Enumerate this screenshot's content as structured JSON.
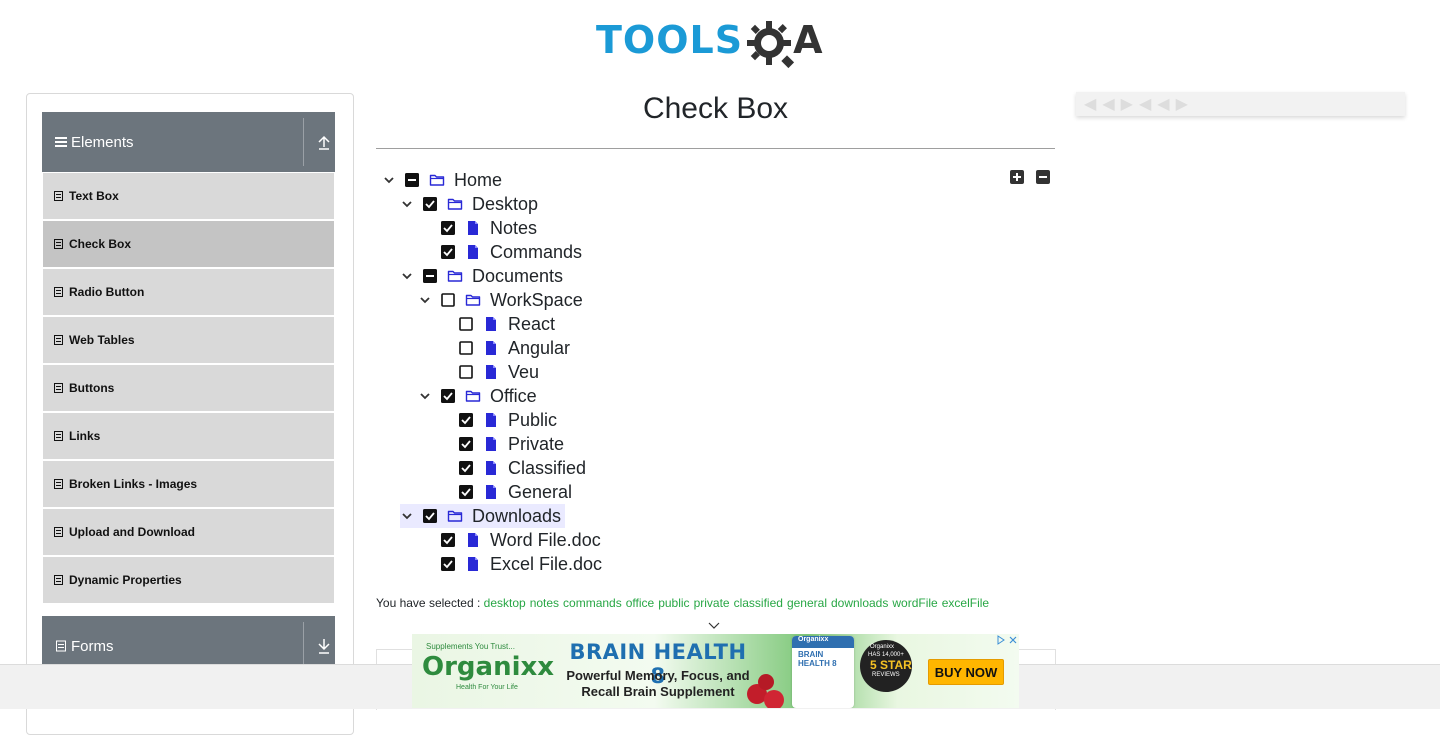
{
  "header": {
    "logo_text": "TOOLS",
    "logo_suffix": "A"
  },
  "sidebar": {
    "groups": [
      {
        "label": "Elements",
        "icon": "hamburger-icon",
        "arrow": "upload-arrow-icon"
      },
      {
        "label": "Forms",
        "icon": "form-icon",
        "arrow": "download-arrow-icon"
      }
    ],
    "items": [
      {
        "label": "Text Box",
        "active": false
      },
      {
        "label": "Check Box",
        "active": true
      },
      {
        "label": "Radio Button",
        "active": false
      },
      {
        "label": "Web Tables",
        "active": false
      },
      {
        "label": "Buttons",
        "active": false
      },
      {
        "label": "Links",
        "active": false
      },
      {
        "label": "Broken Links - Images",
        "active": false
      },
      {
        "label": "Upload and Download",
        "active": false
      },
      {
        "label": "Dynamic Properties",
        "active": false
      }
    ]
  },
  "main": {
    "title": "Check Box",
    "tree": [
      {
        "label": "Home",
        "type": "folder",
        "state": "partial",
        "expanded": true
      },
      {
        "label": "Desktop",
        "type": "folder",
        "state": "checked",
        "expanded": true
      },
      {
        "label": "Notes",
        "type": "file",
        "state": "checked"
      },
      {
        "label": "Commands",
        "type": "file",
        "state": "checked"
      },
      {
        "label": "Documents",
        "type": "folder",
        "state": "partial",
        "expanded": true
      },
      {
        "label": "WorkSpace",
        "type": "folder",
        "state": "unchecked",
        "expanded": true
      },
      {
        "label": "React",
        "type": "file",
        "state": "unchecked"
      },
      {
        "label": "Angular",
        "type": "file",
        "state": "unchecked"
      },
      {
        "label": "Veu",
        "type": "file",
        "state": "unchecked"
      },
      {
        "label": "Office",
        "type": "folder",
        "state": "checked",
        "expanded": true
      },
      {
        "label": "Public",
        "type": "file",
        "state": "checked"
      },
      {
        "label": "Private",
        "type": "file",
        "state": "checked"
      },
      {
        "label": "Classified",
        "type": "file",
        "state": "checked"
      },
      {
        "label": "General",
        "type": "file",
        "state": "checked"
      },
      {
        "label": "Downloads",
        "type": "folder",
        "state": "checked",
        "expanded": true
      },
      {
        "label": "Word File.doc",
        "type": "file",
        "state": "checked"
      },
      {
        "label": "Excel File.doc",
        "type": "file",
        "state": "checked"
      }
    ],
    "result_label": "You have selected :",
    "result_items": [
      "desktop",
      "notes",
      "commands",
      "office",
      "public",
      "private",
      "classified",
      "general",
      "downloads",
      "wordFile",
      "excelFile"
    ]
  },
  "ad_banner": {
    "brand": "Organixx",
    "brand_small": "Supplements You Trust...",
    "brand_tagline": "Health For Your Life",
    "headline": "BRAIN HEALTH 8",
    "subline": "Powerful Memory, Focus, and Recall Brain Supplement",
    "bottle_brand": "Organixx",
    "bottle_text": "BRAIN HEALTH 8",
    "badge_brand": "Organixx",
    "badge_line1": "HAS 14,000+",
    "badge_line2": "5 STAR",
    "badge_line3": "REVIEWS",
    "cta": "BUY NOW"
  },
  "colors": {
    "accent": "#1b9ad6",
    "sidebar_header": "#6c757d",
    "menu_item": "#d9d9d9",
    "menu_item_active": "#c4c4c4",
    "tree_icon": "#2929d6",
    "result_green": "#28a745"
  }
}
